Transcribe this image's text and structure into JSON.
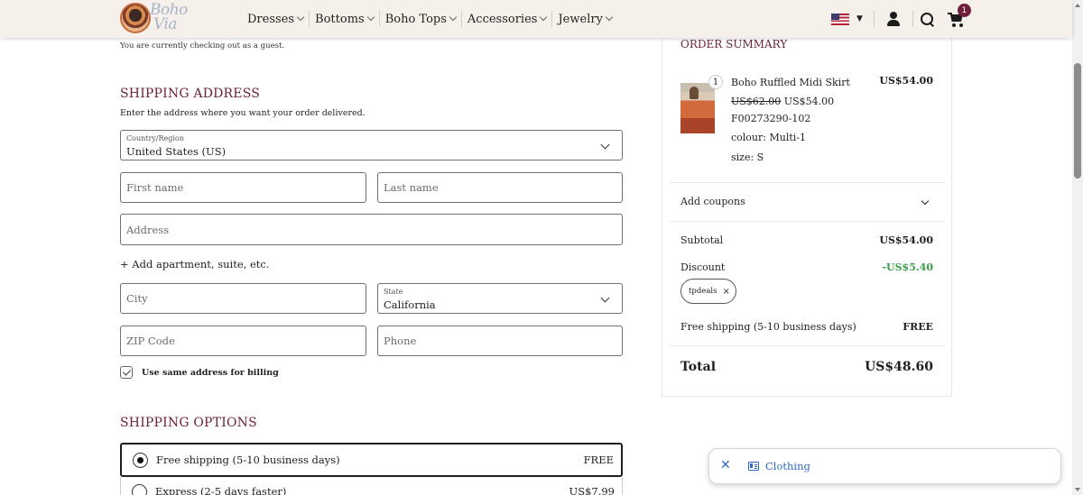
{
  "header": {
    "logo": {
      "line1": "Boho",
      "line2": "Via"
    },
    "nav": [
      "Dresses",
      "Bottoms",
      "Boho Tops",
      "Accessories",
      "Jewelry"
    ],
    "cart_count": "1",
    "flag_caret": "▼"
  },
  "checkout": {
    "guest_note": "You are currently checking out as a guest.",
    "shipping_title": "SHIPPING ADDRESS",
    "shipping_subtitle": "Enter the address where you want your order delivered.",
    "country_label": "Country/Region",
    "country_value": "United States (US)",
    "first_name_placeholder": "First name",
    "last_name_placeholder": "Last name",
    "address_placeholder": "Address",
    "add_apartment": "+ Add apartment, suite, etc.",
    "city_placeholder": "City",
    "state_label": "State",
    "state_value": "California",
    "zip_placeholder": "ZIP Code",
    "phone_placeholder": "Phone",
    "same_billing_label": "Use same address for billing",
    "shipping_options_title": "SHIPPING OPTIONS",
    "options": [
      {
        "label": "Free shipping (5-10 business days)",
        "price": "FREE"
      },
      {
        "label": "Express (2-5 days faster)",
        "price": "US$7.99"
      }
    ]
  },
  "summary": {
    "title": "ORDER SUMMARY",
    "item": {
      "qty": "1",
      "name": "Boho Ruffled Midi Skirt",
      "old_price": "US$62.00",
      "new_price": "US$54.00",
      "sku": "F00273290-102",
      "colour": "colour: Multi-1",
      "size": "size: S",
      "line_total": "US$54.00"
    },
    "add_coupons": "Add coupons",
    "subtotal_label": "Subtotal",
    "subtotal_value": "US$54.00",
    "discount_label": "Discount",
    "discount_value": "-US$5.40",
    "coupon_code": "tpdeals",
    "coupon_remove": "×",
    "shipping_label": "Free shipping (5-10 business days)",
    "shipping_value": "FREE",
    "total_label": "Total",
    "total_value": "US$48.60"
  },
  "chat": {
    "close": "✕",
    "text": "Clothing"
  },
  "colors": {
    "accent": "#6e1f3a",
    "discount": "#3aa04a",
    "chat_blue": "#2f6bc7",
    "header_bg": "#f6f0ea"
  }
}
